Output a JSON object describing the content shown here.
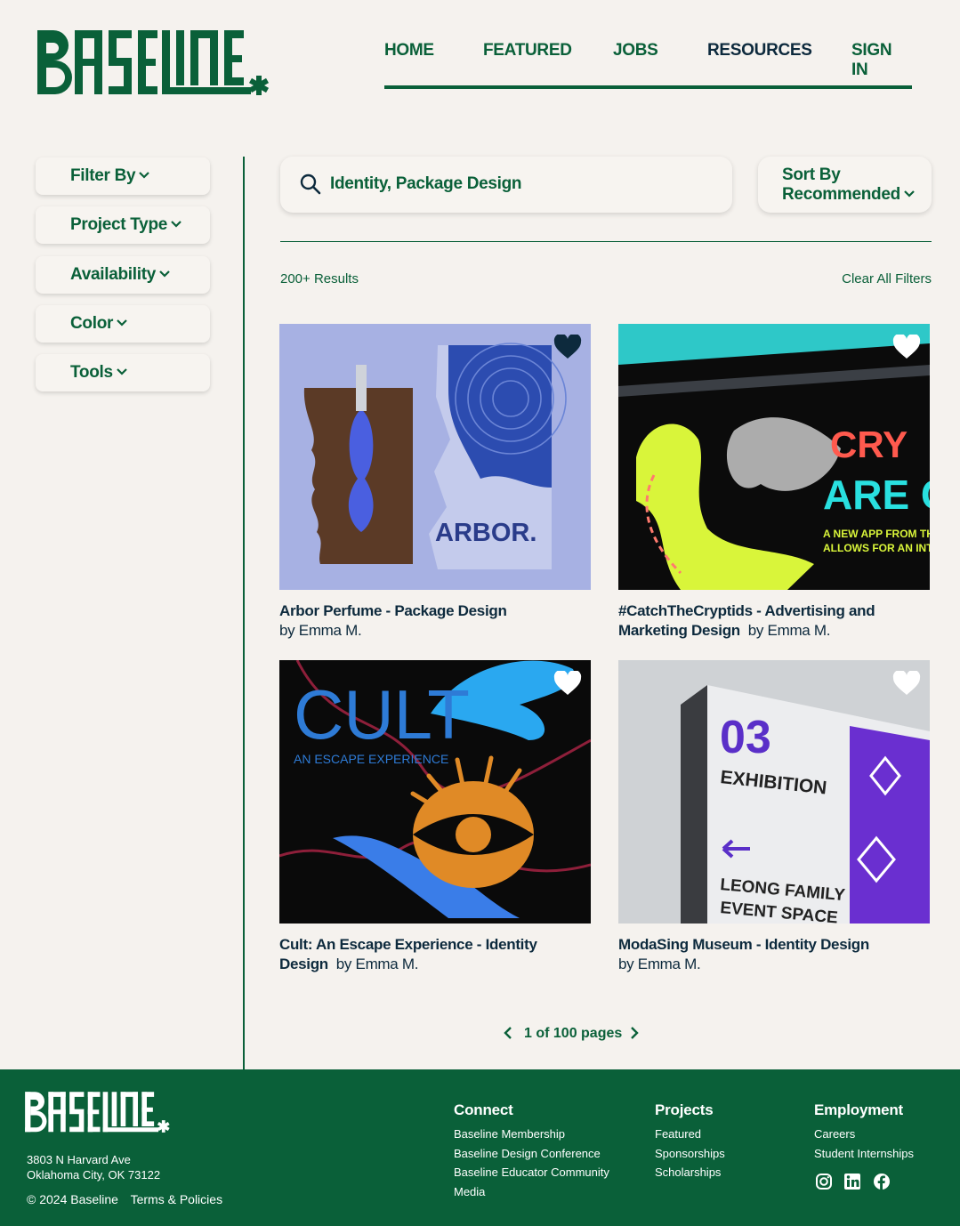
{
  "brand": {
    "name": "BASELINE"
  },
  "nav": {
    "items": [
      "HOME",
      "FEATURED",
      "JOBS",
      "RESOURCES",
      "SIGN IN"
    ],
    "active": "RESOURCES"
  },
  "filters": [
    "Filter By",
    "Project Type",
    "Availability",
    "Color",
    "Tools"
  ],
  "search": {
    "value": "Identity, Package Design"
  },
  "sort": {
    "line1": "Sort By",
    "line2": "Recommended"
  },
  "results": {
    "count": "200+ Results",
    "clear": "Clear All Filters"
  },
  "cards": [
    {
      "title": "Arbor Perfume - Package Design",
      "by": "by Emma M.",
      "favorited": true,
      "art_text": "ARBOR."
    },
    {
      "title": "#CatchTheCryptids - Advertising and Marketing Design",
      "by": "by Emma M.",
      "favorited": false,
      "art_text": "CRY ARE CO",
      "art_sub": "A NEW APP FROM THE NA ALLOWS FOR AN INTERAC"
    },
    {
      "title": "Cult: An Escape Experience - Identity Design",
      "by": "by Emma M.",
      "favorited": false,
      "art_text": "CULT",
      "art_sub": "AN ESCAPE EXPERIENCE"
    },
    {
      "title": "ModaSing Museum - Identity Design",
      "by": "by Emma M.",
      "favorited": false,
      "art_num": "03",
      "art_l1": "EXHIBITION",
      "art_l2": "LEONG FAMILY",
      "art_l3": "EVENT SPACE"
    }
  ],
  "pagination": {
    "label": "1 of 100 pages"
  },
  "footer": {
    "address_line1": "3803 N Harvard Ave",
    "address_line2": "Oklahoma City, OK 73122",
    "copyright": "© 2024 Baseline",
    "terms": "Terms & Policies",
    "columns": [
      {
        "heading": "Connect",
        "links": [
          "Baseline Membership",
          "Baseline Design Conference",
          "Baseline Educator Community",
          "Media"
        ]
      },
      {
        "heading": "Projects",
        "links": [
          "Featured",
          "Sponsorships",
          "Scholarships"
        ]
      },
      {
        "heading": "Employment",
        "links": [
          "Careers",
          "Student Internships"
        ]
      }
    ],
    "social": [
      "instagram-icon",
      "linkedin-icon",
      "facebook-icon"
    ]
  },
  "colors": {
    "brand_green": "#0a6039",
    "navy": "#0d2a3d",
    "background": "#f5f2ee"
  }
}
